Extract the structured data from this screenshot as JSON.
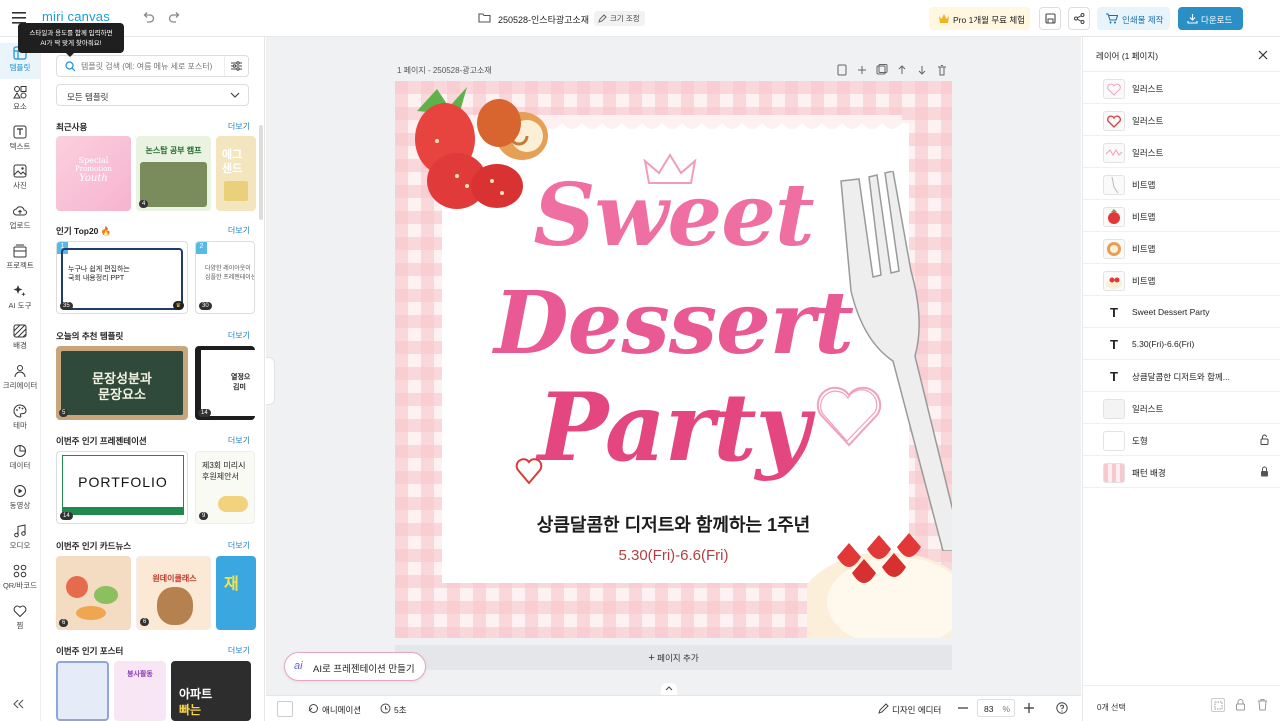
{
  "topbar": {
    "logo": "miri canvas",
    "doc_title": "250528-인스타광고소재",
    "resize_label": "크기 조정",
    "pro_label": "Pro 1개월 무료 체험",
    "print_label": "인쇄물 제작",
    "download_label": "다운로드"
  },
  "tooltip": {
    "line1": "스타일과 용도를 함께 입력하면",
    "line2": "AI가 딱 맞게 찾아줘요!"
  },
  "rail": [
    {
      "label": "템플릿"
    },
    {
      "label": "요소"
    },
    {
      "label": "텍스트"
    },
    {
      "label": "사진"
    },
    {
      "label": "업로드"
    },
    {
      "label": "프로젝트"
    },
    {
      "label": "AI 도구"
    },
    {
      "label": "배경"
    },
    {
      "label": "크리에이터"
    },
    {
      "label": "테마"
    },
    {
      "label": "데이터"
    },
    {
      "label": "동영상"
    },
    {
      "label": "오디오"
    },
    {
      "label": "QR/바코드"
    },
    {
      "label": "찜"
    }
  ],
  "panel": {
    "search_placeholder": "템플릿 검색 (예: 여름 메뉴 세로 포스터)",
    "filter_value": "모든 템플릿",
    "more": "더보기",
    "sections": {
      "recent": "최근사용",
      "top20": "인기 Top20 🔥",
      "today": "오늘의 추천 템플릿",
      "presentation": "이번주 인기 프레젠테이션",
      "cardnews": "이번주 인기 카드뉴스",
      "poster": "이번주 인기 포스터"
    },
    "thumbs": {
      "special": "Special",
      "promotion": "Promotion",
      "youth": "Youth",
      "study_title": "논스탑 공부 캠프",
      "study_badge": "4",
      "sand": "에그",
      "sand2": "샌드",
      "top1_num": "1",
      "top1_line1": "누구나 쉽게 편집하는",
      "top1_line2": "국회 내용정리 PPT",
      "top1_count": "35",
      "top2_num": "2",
      "top2_line1": "다양한 레이아웃이",
      "top2_line2": "심플한 프레젠테이션",
      "top2_count": "30",
      "board_line1": "문장성분과",
      "board_line2": "문장요소",
      "board_count": "5",
      "dark_text1": "열정으",
      "dark_text2": "김미",
      "dark_count": "14",
      "portfolio": "PORTFOLIO",
      "portfolio_count": "14",
      "proposal_line1": "제3회 미리시",
      "proposal_line2": "후원제안서",
      "proposal_count": "9",
      "card1_badge": "6",
      "card2_text": "원데이클래스",
      "card2_badge": "6",
      "card3_text": "재",
      "poster2_text": "봉사활동",
      "poster3_line1": "아파트",
      "poster3_line2": "빠는"
    },
    "ai_button": "AI로 프레젠테이션 만들기"
  },
  "canvas": {
    "page_label": "1 페이지 - 250528-광고소재",
    "title_line1": "Sweet",
    "title_line2": "Dessert",
    "title_line3": "Party",
    "subtitle": "상큼달콤한 디저트와 함께하는 1주년",
    "date": "5.30(Fri)-6.6(Fri)",
    "add_page": "페이지 추가"
  },
  "bottombar": {
    "animation": "애니메이션",
    "duration": "5초",
    "design_editor": "디자인 에디터",
    "zoom_value": "83",
    "zoom_unit": "%"
  },
  "layers": {
    "title": "레이어 (1 페이지)",
    "items": [
      {
        "name": "일러스트"
      },
      {
        "name": "일러스트"
      },
      {
        "name": "일러스트"
      },
      {
        "name": "비트맵"
      },
      {
        "name": "비트맵"
      },
      {
        "name": "비트맵"
      },
      {
        "name": "비트맵"
      },
      {
        "name": "Sweet Dessert Party"
      },
      {
        "name": "5.30(Fri)-6.6(Fri)"
      },
      {
        "name": "상큼달콤한 디저트와 함께..."
      },
      {
        "name": "일러스트"
      },
      {
        "name": "도형"
      },
      {
        "name": "패턴 배경"
      }
    ],
    "selection": "0개 선택"
  },
  "colors": {
    "accent": "#1e8fd6",
    "title_pink": "#ef6fa3",
    "date_red": "#b04040",
    "gingham": "#f7c9cf"
  }
}
